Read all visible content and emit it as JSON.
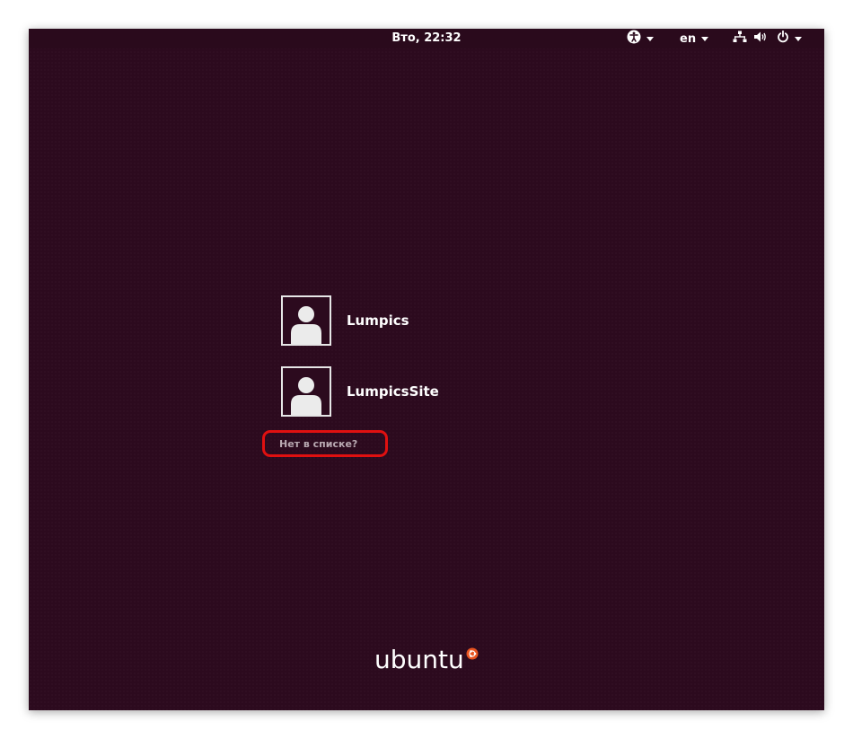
{
  "topbar": {
    "clock": "Вто, 22:32",
    "language": "en",
    "icons": [
      "accessibility-icon",
      "network-icon",
      "volume-icon",
      "power-icon"
    ]
  },
  "users": [
    {
      "name": "Lumpics"
    },
    {
      "name": "LumpicsSite"
    }
  ],
  "not_listed_label": "Нет в списке?",
  "branding": {
    "logo_text": "ubuntu"
  },
  "colors": {
    "background": "#2c0a1e",
    "highlight": "#e01010",
    "logo_accent": "#e95420"
  }
}
